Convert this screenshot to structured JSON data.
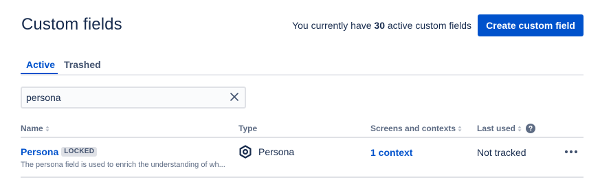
{
  "header": {
    "title": "Custom fields",
    "count_prefix": "You currently have",
    "count_value": "30",
    "count_suffix": "active custom fields",
    "create_button_label": "Create custom field"
  },
  "tabs": [
    {
      "label": "Active",
      "active": true
    },
    {
      "label": "Trashed",
      "active": false
    }
  ],
  "search": {
    "value": "persona",
    "placeholder": ""
  },
  "table": {
    "columns": [
      {
        "label": "Name",
        "sortable": true
      },
      {
        "label": "Type",
        "sortable": false
      },
      {
        "label": "Screens and contexts",
        "sortable": true
      },
      {
        "label": "Last used",
        "sortable": true,
        "help": true
      }
    ],
    "rows": [
      {
        "name": "Persona",
        "badge": "LOCKED",
        "description": "The persona field is used to enrich the understanding of wh...",
        "type": "Persona",
        "type_icon": "hexagon-icon",
        "contexts": "1 context",
        "last_used": "Not tracked"
      }
    ]
  },
  "colors": {
    "accent": "#0052cc",
    "text": "#172b4d",
    "subtle": "#5e6c84",
    "border": "#dfe1e6"
  }
}
